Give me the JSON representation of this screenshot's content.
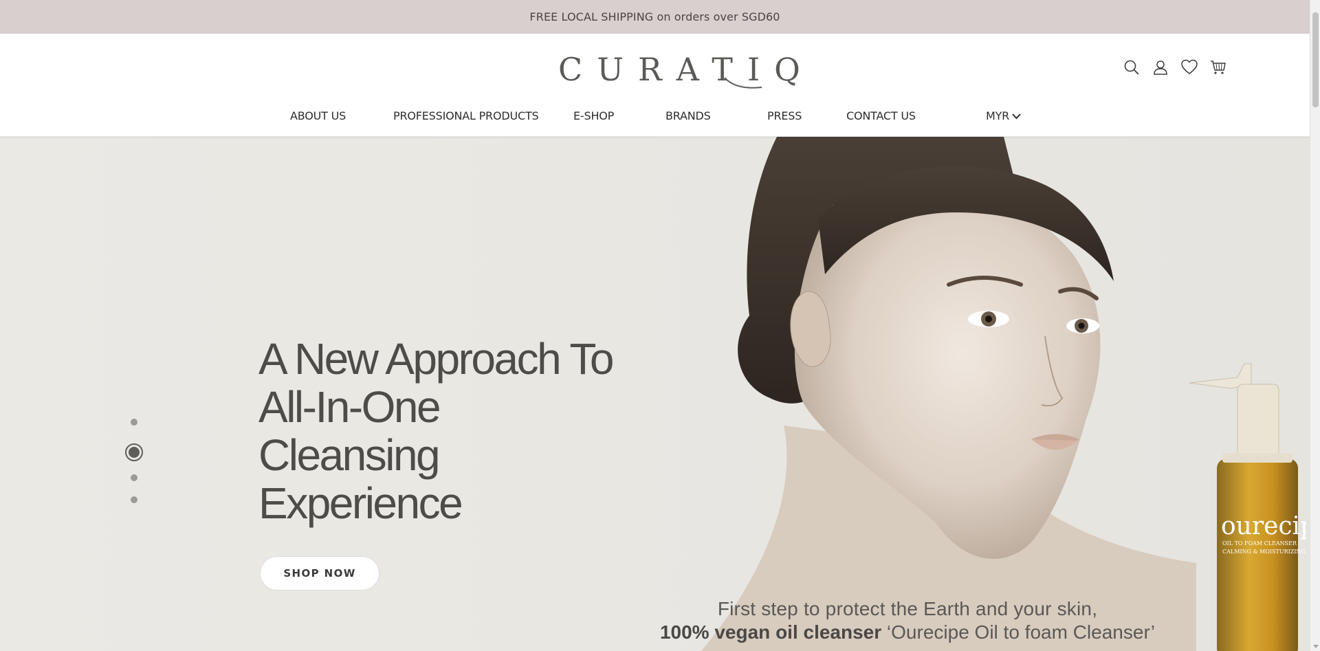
{
  "announcement": {
    "text": "FREE LOCAL SHIPPING on orders over SGD60"
  },
  "brand": {
    "logo_text": "CURATIQ"
  },
  "header_icons": [
    "search-icon",
    "account-icon",
    "wishlist-icon",
    "cart-icon"
  ],
  "nav": {
    "items": [
      {
        "label": "ABOUT US"
      },
      {
        "label": "PROFESSIONAL PRODUCTS"
      },
      {
        "label": "E-SHOP"
      },
      {
        "label": "BRANDS"
      },
      {
        "label": "PRESS"
      },
      {
        "label": "CONTACT US"
      }
    ],
    "currency": "MYR"
  },
  "hero": {
    "headline_lines": [
      "A New Approach To",
      "All-In-One",
      "Cleansing",
      "Experience"
    ],
    "cta_label": "SHOP NOW",
    "caption_line1": "First step to protect the Earth and your skin,",
    "caption_line2_bold": "100% vegan oil cleanser",
    "caption_line2_rest": " ‘Ourecipe Oil to foam Cleanser’",
    "bottle_brand": "ourecipe",
    "bottle_sub1": "OIL TO FOAM CLEANSER",
    "bottle_sub2": "CALMING & MOISTURIZING",
    "slides_total": 4,
    "active_slide": 2
  },
  "colors": {
    "announcement_bg": "#d9cfcf",
    "hero_bg": "#ebe9e4",
    "text_dark": "#4e4c49"
  }
}
